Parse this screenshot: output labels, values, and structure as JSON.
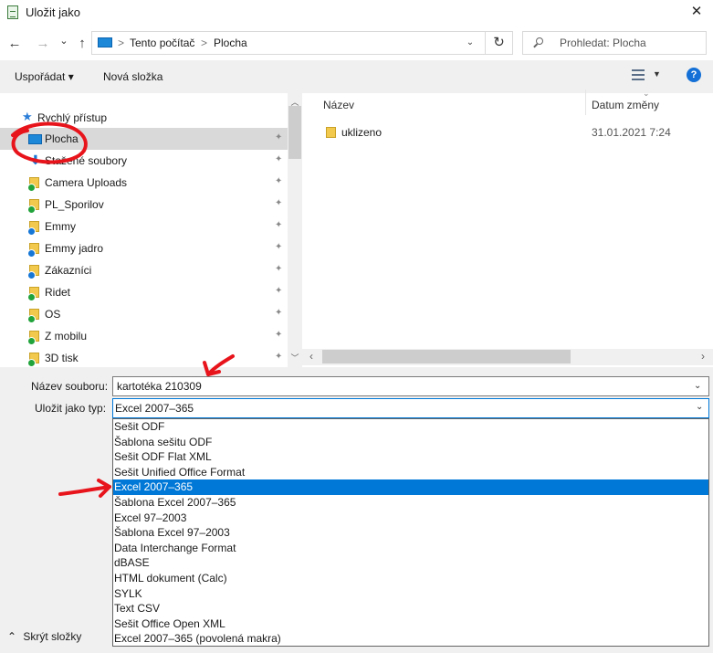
{
  "window": {
    "title": "Uložit jako",
    "close_glyph": "✕"
  },
  "nav": {
    "back_glyph": "←",
    "forward_glyph": "→",
    "recent_glyph": "⌄",
    "up_glyph": "↑",
    "address": {
      "part1": "Tento počítač",
      "separator": ">",
      "part2": "Plocha"
    },
    "refresh_glyph": "↻",
    "search_placeholder": "Prohledat: Plocha"
  },
  "toolbar": {
    "organize_label": "Uspořádat ▾",
    "new_folder_label": "Nová složka",
    "help_label": "?"
  },
  "nav_pane": {
    "quick_access_label": "Rychlý přístup",
    "items": [
      {
        "label": "Plocha",
        "selected": true
      },
      {
        "label": "Stažené soubory"
      },
      {
        "label": "Camera Uploads"
      },
      {
        "label": "PL_Sporilov"
      },
      {
        "label": "Emmy"
      },
      {
        "label": "Emmy jadro"
      },
      {
        "label": "Zákazníci"
      },
      {
        "label": "Ridet"
      },
      {
        "label": "OS"
      },
      {
        "label": "Z mobilu"
      },
      {
        "label": "3D tisk"
      }
    ],
    "pin_glyph": "📌"
  },
  "file_list": {
    "col_name": "Název",
    "col_date": "Datum změny",
    "rows": [
      {
        "name": "uklizeno",
        "date": "31.01.2021 7:24"
      }
    ]
  },
  "form": {
    "filename_label": "Název souboru:",
    "filename_value": "kartotéka 210309",
    "filetype_label": "Uložit jako typ:",
    "filetype_value": "Excel 2007–365",
    "filetype_options": [
      "Sešit ODF",
      "Šablona sešitu ODF",
      "Sešit ODF Flat XML",
      "Sešit Unified Office Format",
      "Excel 2007–365",
      "Šablona Excel 2007–365",
      "Excel 97–2003",
      "Šablona Excel 97–2003",
      "Data Interchange Format",
      "dBASE",
      "HTML dokument (Calc)",
      "SYLK",
      "Text CSV",
      "Sešit Office Open XML",
      "Excel 2007–365 (povolená makra)"
    ],
    "selected_option_index": 4,
    "caret_glyph": "⌄"
  },
  "footer": {
    "hide_folders_label": "Skrýt složky",
    "hide_glyph": "⌃"
  },
  "colors": {
    "accent": "#0078d7",
    "annotation": "#e8141c"
  }
}
